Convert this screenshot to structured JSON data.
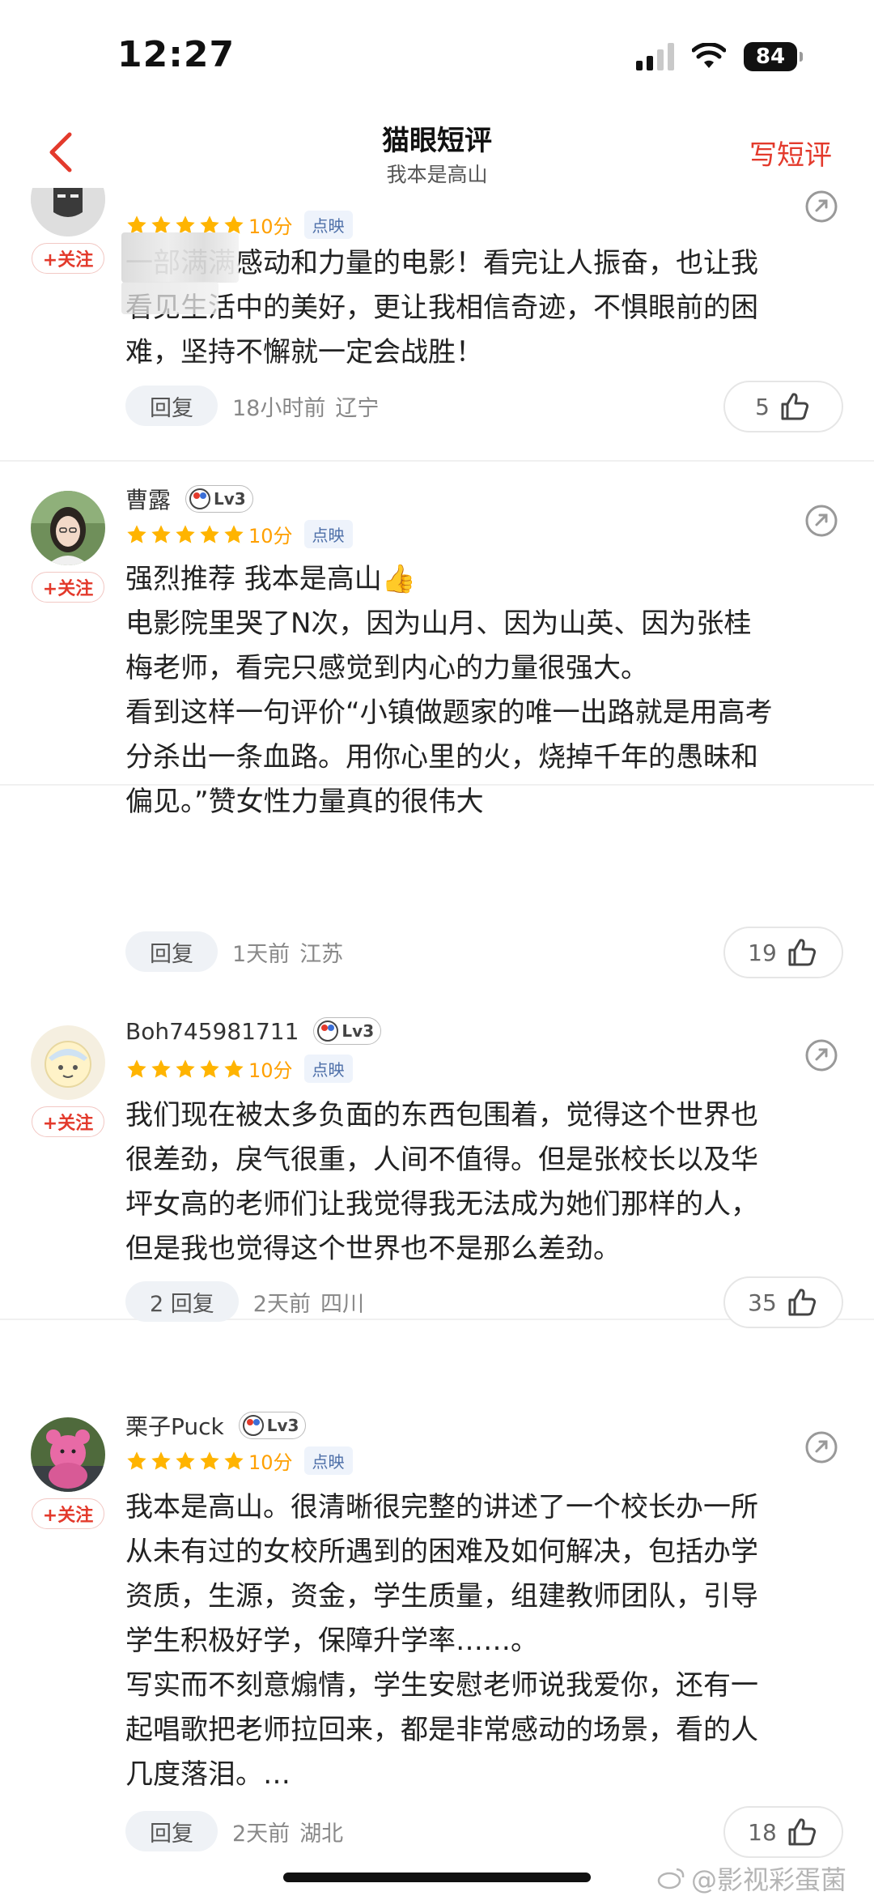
{
  "status_bar": {
    "time": "12:27",
    "battery": "84"
  },
  "nav": {
    "title": "猫眼短评",
    "subtitle": "我本是高山",
    "action": "写短评"
  },
  "reviews": [
    {
      "username": "",
      "level": "",
      "score": "10分",
      "tag": "点映",
      "follow": "+关注",
      "content": "一部满满感动和力量的电影！看完让人振奋，也让我\n看见生活中的美好，更让我相信奇迹，不惧眼前的困\n难，坚持不懈就一定会战胜！",
      "reply": "回复",
      "time": "18小时前",
      "location": "辽宁",
      "likes": "5"
    },
    {
      "username": "曹露",
      "level": "Lv3",
      "score": "10分",
      "tag": "点映",
      "follow": "+关注",
      "content": "强烈推荐 我本是高山👍\n电影院里哭了N次，因为山月、因为山英、因为张桂\n梅老师，看完只感觉到内心的力量很强大。\n看到这样一句评价“小镇做题家的唯一出路就是用高考\n分杀出一条血路。用你心里的火，烧掉千年的愚昧和\n偏见。”赞女性力量真的很伟大",
      "reply": "回复",
      "time": "1天前",
      "location": "江苏",
      "likes": "19"
    },
    {
      "username": "Boh745981711",
      "level": "Lv3",
      "score": "10分",
      "tag": "点映",
      "follow": "+关注",
      "content": "我们现在被太多负面的东西包围着，觉得这个世界也\n很差劲，戾气很重，人间不值得。但是张校长以及华\n坪女高的老师们让我觉得我无法成为她们那样的人，\n但是我也觉得这个世界也不是那么差劲。",
      "reply": "2 回复",
      "time": "2天前",
      "location": "四川",
      "likes": "35"
    },
    {
      "username": "栗子Puck",
      "level": "Lv3",
      "score": "10分",
      "tag": "点映",
      "follow": "+关注",
      "content": "我本是高山。很清晰很完整的讲述了一个校长办一所\n从未有过的女校所遇到的困难及如何解决，包括办学\n资质，生源，资金，学生质量，组建教师团队，引导\n学生积极好学，保障升学率……。\n写实而不刻意煽情，学生安慰老师说我爱你，还有一\n起唱歌把老师拉回来，都是非常感动的场景，看的人\n几度落泪。…",
      "reply": "回复",
      "time": "2天前",
      "location": "湖北",
      "likes": "18"
    }
  ],
  "watermark": "@影视彩蛋菌",
  "colors": {
    "accent": "#e33a2c",
    "star": "#ffb400",
    "score": "#ffa000"
  }
}
